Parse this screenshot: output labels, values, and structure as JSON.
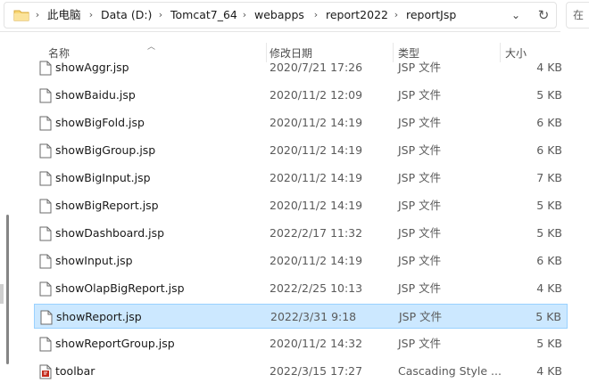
{
  "breadcrumb": {
    "segments": [
      "此电脑",
      "Data (D:)",
      "Tomcat7_64",
      "webapps",
      "report2022",
      "reportJsp"
    ],
    "search_partial": "在"
  },
  "columns": {
    "name": "名称",
    "date": "修改日期",
    "type": "类型",
    "size": "大小"
  },
  "files": [
    {
      "name": "showAggr.jsp",
      "date": "2020/7/21 17:26",
      "type": "JSP 文件",
      "size": "4 KB",
      "icon": "file-icon"
    },
    {
      "name": "showBaidu.jsp",
      "date": "2020/11/2 12:09",
      "type": "JSP 文件",
      "size": "5 KB",
      "icon": "file-icon"
    },
    {
      "name": "showBigFold.jsp",
      "date": "2020/11/2 14:19",
      "type": "JSP 文件",
      "size": "6 KB",
      "icon": "file-icon"
    },
    {
      "name": "showBigGroup.jsp",
      "date": "2020/11/2 14:19",
      "type": "JSP 文件",
      "size": "6 KB",
      "icon": "file-icon"
    },
    {
      "name": "showBigInput.jsp",
      "date": "2020/11/2 14:19",
      "type": "JSP 文件",
      "size": "7 KB",
      "icon": "file-icon"
    },
    {
      "name": "showBigReport.jsp",
      "date": "2020/11/2 14:19",
      "type": "JSP 文件",
      "size": "5 KB",
      "icon": "file-icon"
    },
    {
      "name": "showDashboard.jsp",
      "date": "2022/2/17 11:32",
      "type": "JSP 文件",
      "size": "5 KB",
      "icon": "file-icon"
    },
    {
      "name": "showInput.jsp",
      "date": "2020/11/2 14:19",
      "type": "JSP 文件",
      "size": "6 KB",
      "icon": "file-icon"
    },
    {
      "name": "showOlapBigReport.jsp",
      "date": "2022/2/25 10:13",
      "type": "JSP 文件",
      "size": "4 KB",
      "icon": "file-icon"
    },
    {
      "name": "showReport.jsp",
      "date": "2022/3/31 9:18",
      "type": "JSP 文件",
      "size": "5 KB",
      "icon": "file-icon",
      "selected": true
    },
    {
      "name": "showReportGroup.jsp",
      "date": "2020/11/2 14:32",
      "type": "JSP 文件",
      "size": "5 KB",
      "icon": "file-icon"
    },
    {
      "name": "toolbar",
      "date": "2022/3/15 17:27",
      "type": "Cascading Style ...",
      "size": "4 KB",
      "icon": "css-file-icon"
    }
  ],
  "colors": {
    "selection_fill": "#cce8ff",
    "selection_border": "#99d1ff",
    "folder": "#f8d775",
    "css_icon": "#c42b1c"
  }
}
